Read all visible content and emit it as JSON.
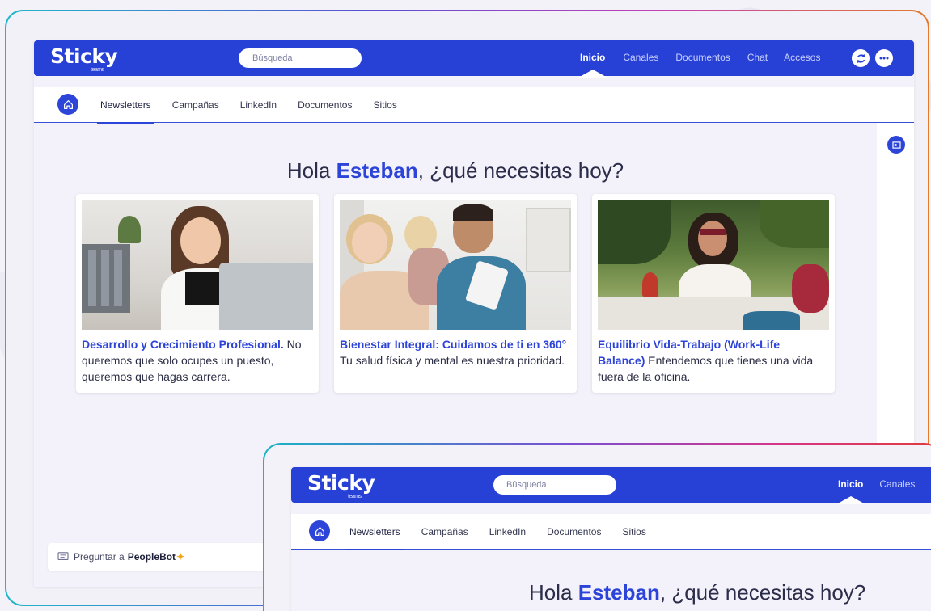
{
  "app": {
    "logo": "Sticky",
    "logo_sub": "teams",
    "search_placeholder": "Búsqueda"
  },
  "topnav": {
    "items": [
      "Inicio",
      "Canales",
      "Documentos",
      "Chat",
      "Accesos"
    ],
    "active": "Inicio",
    "refresh_icon": "refresh-icon",
    "more_icon": "more-icon"
  },
  "subnav": {
    "tabs": [
      "Newsletters",
      "Campañas",
      "LinkedIn",
      "Documentos",
      "Sitios"
    ],
    "active": "Newsletters"
  },
  "greeting": {
    "prefix": "Hola ",
    "name": "Esteban",
    "suffix": ", ¿qué necesitas hoy?"
  },
  "cards": [
    {
      "title": "Desarrollo y Crecimiento Profesional.",
      "body": " No queremos que solo ocupes un puesto, queremos que hagas carrera."
    },
    {
      "title": "Bienestar Integral: Cuidamos de ti en 360°",
      "body": " Tu salud física y mental es nuestra prioridad."
    },
    {
      "title": "Equilibrio Vida-Trabajo (Work-Life Balance)",
      "body": " Entendemos que tienes una vida fuera de la oficina."
    }
  ],
  "peoplebot": {
    "prefix": "Preguntar a",
    "name": "PeopleBot"
  },
  "second": {
    "logo": "Sticky",
    "logo_sub": "teams",
    "search_placeholder": "Búsqueda",
    "topnav": [
      "Inicio",
      "Canales"
    ],
    "tabs": [
      "Newsletters",
      "Campañas",
      "LinkedIn",
      "Documentos",
      "Sitios"
    ],
    "greeting_prefix": "Hola ",
    "greeting_name": "Esteban",
    "greeting_suffix": ", ¿qué necesitas hoy?"
  },
  "colors": {
    "brand": "#2740d6",
    "accent": "#2d44d8",
    "background": "#f3f2fa"
  }
}
